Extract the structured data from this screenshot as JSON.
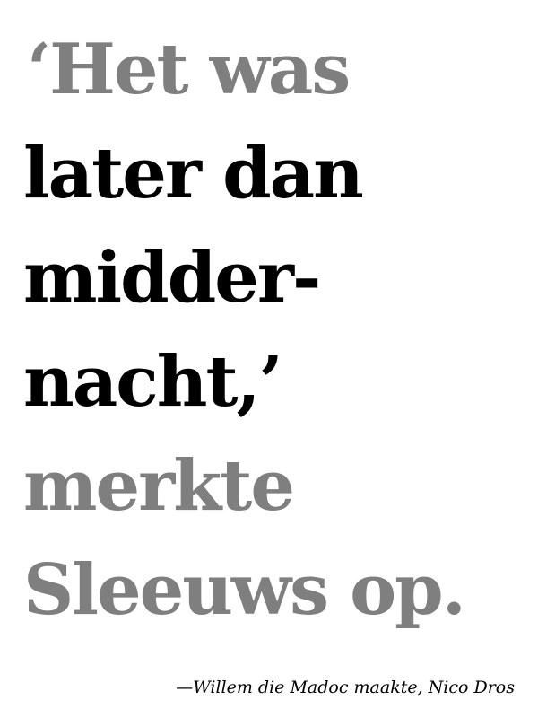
{
  "quote": {
    "lines": [
      {
        "text": "‘Het was",
        "color": "#7f7f7f"
      },
      {
        "text": "later dan",
        "color": "#000000"
      },
      {
        "text": "midder-",
        "color": "#000000"
      },
      {
        "text": "nacht,’",
        "color": "#000000"
      },
      {
        "text": "merkte",
        "color": "#7f7f7f"
      },
      {
        "text": "Sleeuws op.",
        "color": "#7f7f7f"
      }
    ]
  },
  "attribution": {
    "text": "—Willem die Madoc maakte, Nico Dros"
  }
}
